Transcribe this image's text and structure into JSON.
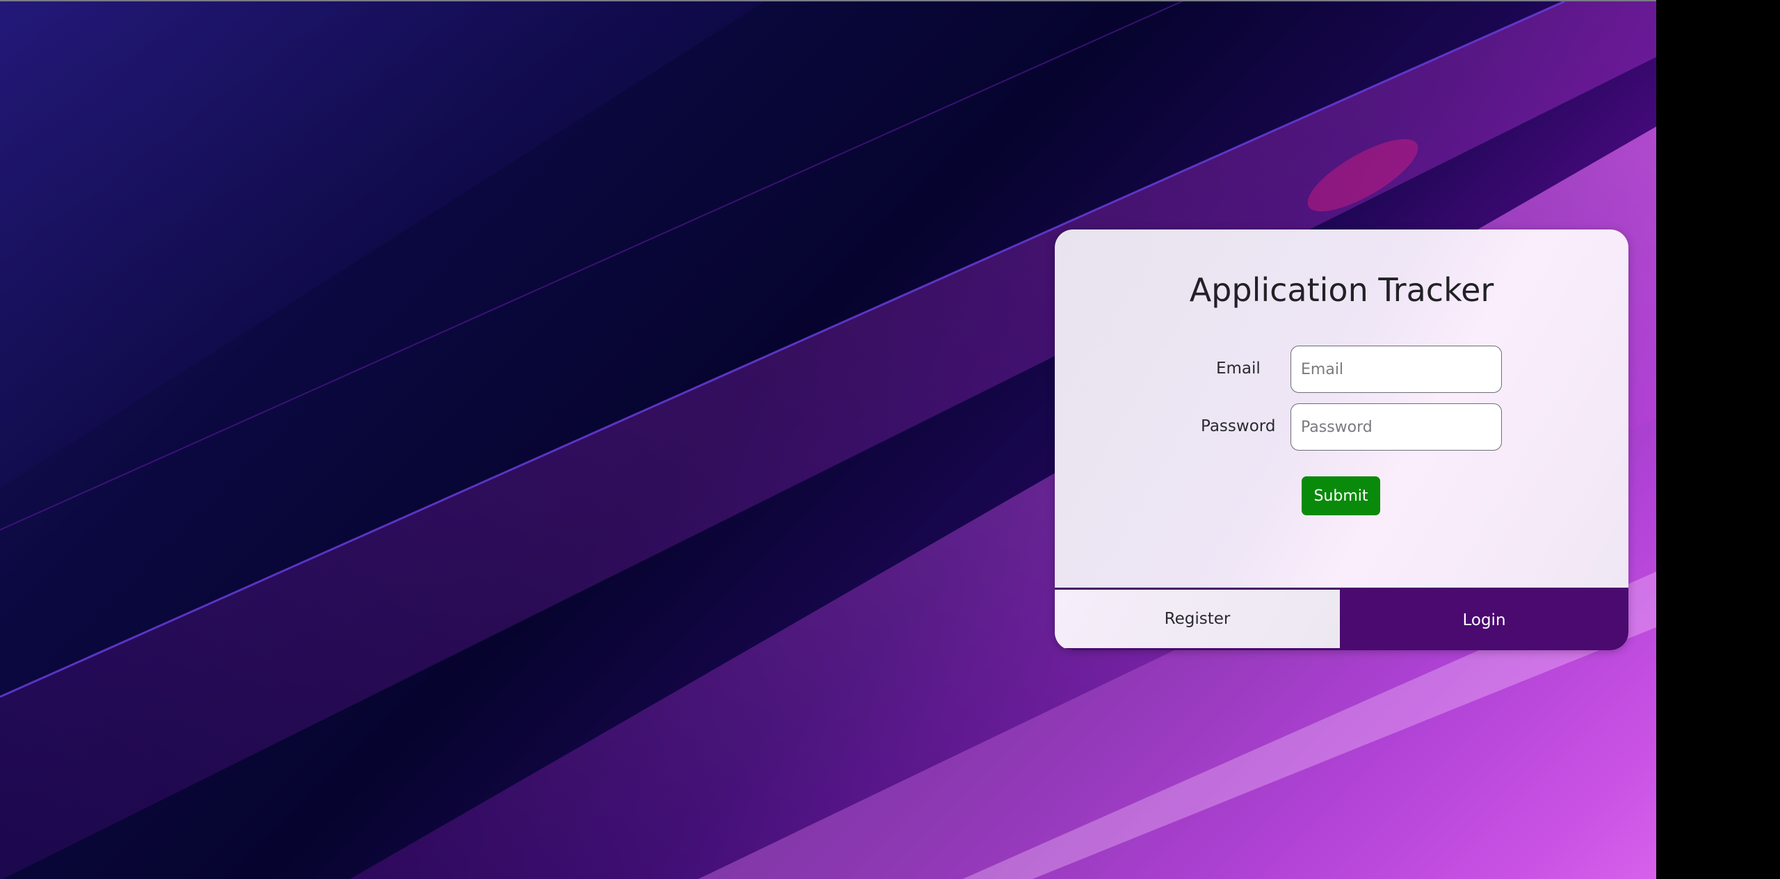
{
  "app": {
    "title": "Application Tracker"
  },
  "form": {
    "email_label": "Email",
    "email_placeholder": "Email",
    "email_value": "",
    "password_label": "Password",
    "password_placeholder": "Password",
    "password_value": "",
    "submit_label": "Submit"
  },
  "tabs": [
    {
      "label": "Register",
      "active": false
    },
    {
      "label": "Login",
      "active": true
    }
  ],
  "colors": {
    "accent": "#4a0a70",
    "submit": "#0a8a0a",
    "text": "#222226"
  }
}
